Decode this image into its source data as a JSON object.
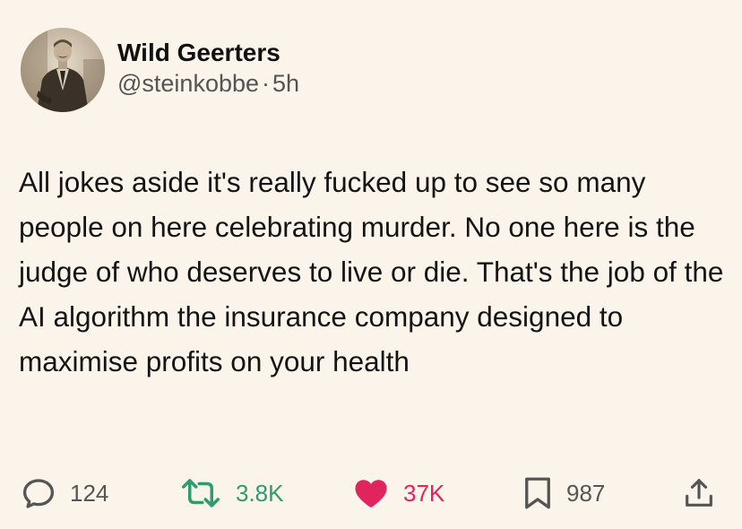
{
  "author": {
    "display_name": "Wild Geerters",
    "handle": "@steinkobbe",
    "separator": "·",
    "time": "5h"
  },
  "tweet": {
    "text": "All jokes aside it's really fucked up to see so many people on here celebrating murder. No one here is the judge of who deserves to live or die. That's the job of the AI algorithm the insurance company designed to maximise profits on your health"
  },
  "actions": {
    "replies": "124",
    "reposts": "3.8K",
    "likes": "37K",
    "bookmarks": "987"
  },
  "icons": {
    "reply": "speech-bubble-icon",
    "repost": "repost-arrows-icon",
    "like": "heart-icon",
    "bookmark": "bookmark-icon",
    "share": "share-icon"
  },
  "colors": {
    "background": "#fbf4ea",
    "repost": "#2f9b70",
    "like": "#e0245e",
    "muted": "#545454"
  }
}
